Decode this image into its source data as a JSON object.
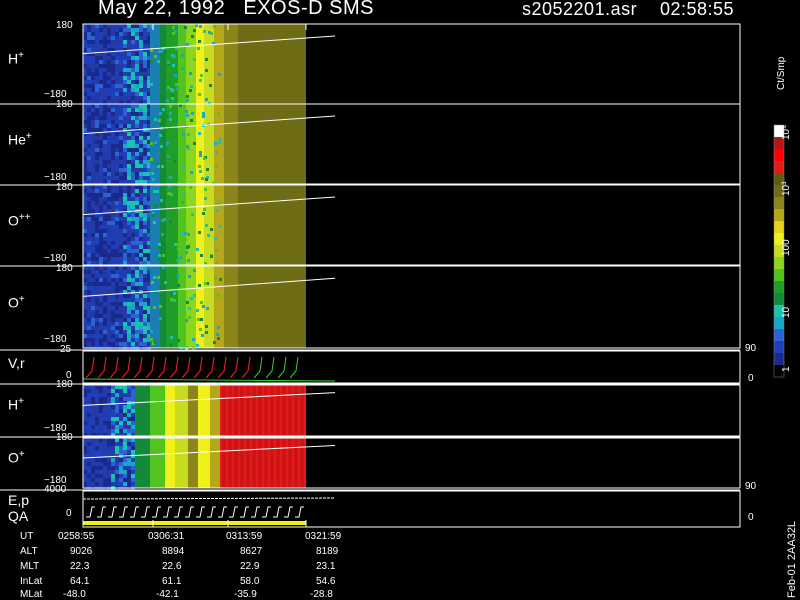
{
  "header": {
    "title": "May 22, 1992   EXOS-D SMS",
    "file": "s2052201.asr",
    "time": "02:58:55"
  },
  "colorbar": {
    "unit_label": "Ct/Smp",
    "ticks": [
      "1",
      "10",
      "100",
      "10³",
      "10⁴"
    ],
    "colors": [
      "#000000",
      "#1a2a8c",
      "#1f3fb8",
      "#2a64d4",
      "#1aa6c4",
      "#19c3b0",
      "#128a3a",
      "#1f9e2a",
      "#52c41f",
      "#8cd61f",
      "#c8dc1f",
      "#f0f01a",
      "#e6d21a",
      "#b4a81a",
      "#8c861a",
      "#6e6c14",
      "#5a5a10",
      "#e61a1a",
      "#ff0000",
      "#b41414",
      "#ffffff"
    ]
  },
  "side_label": "Feb-01 2AA32L",
  "ut_table": {
    "rows": [
      {
        "label": "UT",
        "values": [
          "0258:55",
          "0306:31",
          "0313:59",
          "0321:59"
        ]
      },
      {
        "label": "ALT",
        "values": [
          "9026",
          "8894",
          "8627",
          "8189"
        ]
      },
      {
        "label": "MLT",
        "values": [
          "22.3",
          "22.6",
          "22.9",
          "23.1"
        ]
      },
      {
        "label": "InLat",
        "values": [
          "64.1",
          "61.1",
          "58.0",
          "54.6"
        ]
      },
      {
        "label": "MLat",
        "values": [
          "-48.0",
          "-42.1",
          "-35.9",
          "-28.8"
        ]
      }
    ]
  },
  "chart_data": {
    "type": "heatmap",
    "title": "May 22, 1992   EXOS-D SMS",
    "panels": [
      {
        "label_base": "H",
        "label_sup": "+",
        "y_top": "180",
        "y_bottom": "−180"
      },
      {
        "label_base": "He",
        "label_sup": "+",
        "y_top": "180",
        "y_bottom": "−180"
      },
      {
        "label_base": "O",
        "label_sup": "++",
        "y_top": "180",
        "y_bottom": "−180"
      },
      {
        "label_base": "O",
        "label_sup": "+",
        "y_top": "180",
        "y_bottom": "−180"
      },
      {
        "label_base": "V,r",
        "label_sup": "",
        "y_top": "25",
        "y_bottom": "0",
        "right_top": "90",
        "right_bottom": "0"
      },
      {
        "label_base": "H",
        "label_sup": "+",
        "y_top": "180",
        "y_bottom": "−180"
      },
      {
        "label_base": "O",
        "label_sup": "+",
        "y_top": "180",
        "y_bottom": "−180"
      },
      {
        "label_base": "E,p",
        "label_sup": "",
        "label2": "QA",
        "y_top": "4000",
        "y_bottom": "0",
        "right_top": "90",
        "right_bottom": "0"
      }
    ],
    "time_ticks": [
      "0258:55",
      "0306:31",
      "0313:59",
      "0321:59"
    ]
  }
}
